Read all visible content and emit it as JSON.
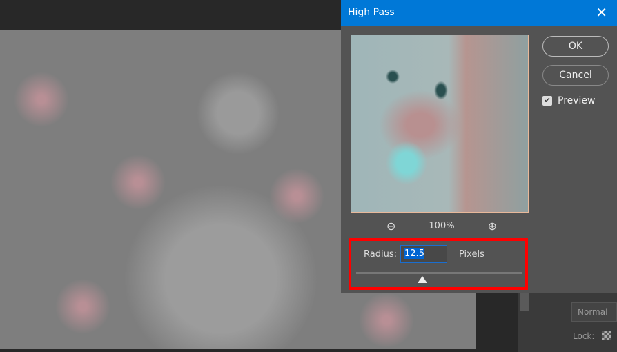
{
  "dialog": {
    "title": "High Pass",
    "ok_label": "OK",
    "cancel_label": "Cancel",
    "preview_label": "Preview",
    "preview_checked": true,
    "zoom_level": "100%",
    "radius_label": "Radius:",
    "radius_value": "12.5",
    "units_label": "Pixels",
    "slider_fraction": 0.4
  },
  "layers_panel": {
    "blend_mode": "Normal",
    "lock_label": "Lock:"
  },
  "colors": {
    "title_bar": "#0078d7",
    "highlight": "#ff0000"
  }
}
